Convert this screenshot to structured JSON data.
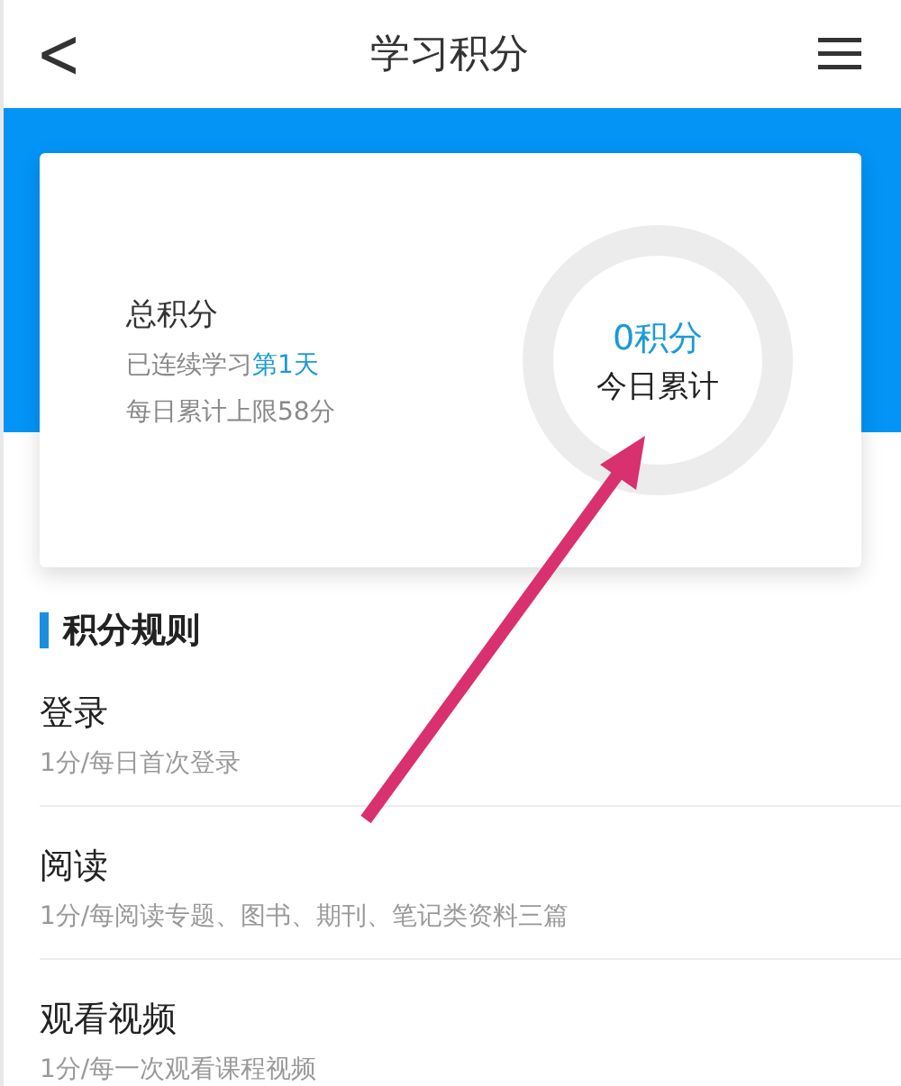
{
  "header": {
    "back": "<",
    "title": "学习积分"
  },
  "summary": {
    "label": "总积分",
    "streak_text": "已连续学习",
    "streak_highlight": "第1天",
    "limit": "每日累计上限58分",
    "today_value": "0积分",
    "today_label": "今日累计"
  },
  "rules": {
    "title": "积分规则",
    "items": [
      {
        "name": "登录",
        "desc": "1分/每日首次登录"
      },
      {
        "name": "阅读",
        "desc": "1分/每阅读专题、图书、期刊、笔记类资料三篇"
      },
      {
        "name": "观看视频",
        "desc": "1分/每一次观看课程视频"
      }
    ]
  }
}
